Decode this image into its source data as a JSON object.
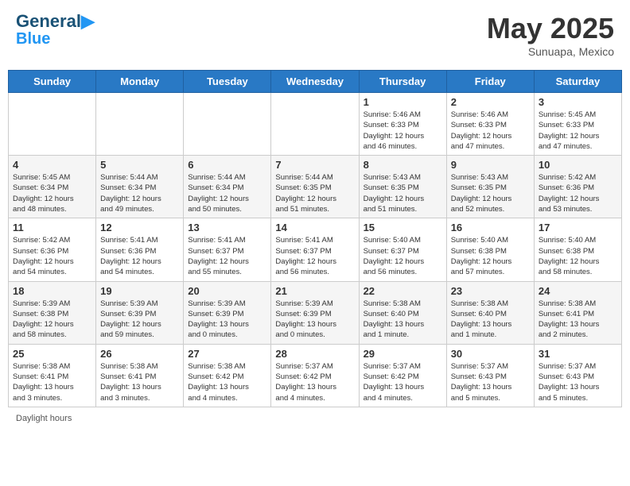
{
  "header": {
    "logo_line1": "General",
    "logo_line2": "Blue",
    "month_title": "May 2025",
    "subtitle": "Sunuapa, Mexico"
  },
  "days_of_week": [
    "Sunday",
    "Monday",
    "Tuesday",
    "Wednesday",
    "Thursday",
    "Friday",
    "Saturday"
  ],
  "weeks": [
    [
      {
        "day": "",
        "info": ""
      },
      {
        "day": "",
        "info": ""
      },
      {
        "day": "",
        "info": ""
      },
      {
        "day": "",
        "info": ""
      },
      {
        "day": "1",
        "info": "Sunrise: 5:46 AM\nSunset: 6:33 PM\nDaylight: 12 hours\nand 46 minutes."
      },
      {
        "day": "2",
        "info": "Sunrise: 5:46 AM\nSunset: 6:33 PM\nDaylight: 12 hours\nand 47 minutes."
      },
      {
        "day": "3",
        "info": "Sunrise: 5:45 AM\nSunset: 6:33 PM\nDaylight: 12 hours\nand 47 minutes."
      }
    ],
    [
      {
        "day": "4",
        "info": "Sunrise: 5:45 AM\nSunset: 6:34 PM\nDaylight: 12 hours\nand 48 minutes."
      },
      {
        "day": "5",
        "info": "Sunrise: 5:44 AM\nSunset: 6:34 PM\nDaylight: 12 hours\nand 49 minutes."
      },
      {
        "day": "6",
        "info": "Sunrise: 5:44 AM\nSunset: 6:34 PM\nDaylight: 12 hours\nand 50 minutes."
      },
      {
        "day": "7",
        "info": "Sunrise: 5:44 AM\nSunset: 6:35 PM\nDaylight: 12 hours\nand 51 minutes."
      },
      {
        "day": "8",
        "info": "Sunrise: 5:43 AM\nSunset: 6:35 PM\nDaylight: 12 hours\nand 51 minutes."
      },
      {
        "day": "9",
        "info": "Sunrise: 5:43 AM\nSunset: 6:35 PM\nDaylight: 12 hours\nand 52 minutes."
      },
      {
        "day": "10",
        "info": "Sunrise: 5:42 AM\nSunset: 6:36 PM\nDaylight: 12 hours\nand 53 minutes."
      }
    ],
    [
      {
        "day": "11",
        "info": "Sunrise: 5:42 AM\nSunset: 6:36 PM\nDaylight: 12 hours\nand 54 minutes."
      },
      {
        "day": "12",
        "info": "Sunrise: 5:41 AM\nSunset: 6:36 PM\nDaylight: 12 hours\nand 54 minutes."
      },
      {
        "day": "13",
        "info": "Sunrise: 5:41 AM\nSunset: 6:37 PM\nDaylight: 12 hours\nand 55 minutes."
      },
      {
        "day": "14",
        "info": "Sunrise: 5:41 AM\nSunset: 6:37 PM\nDaylight: 12 hours\nand 56 minutes."
      },
      {
        "day": "15",
        "info": "Sunrise: 5:40 AM\nSunset: 6:37 PM\nDaylight: 12 hours\nand 56 minutes."
      },
      {
        "day": "16",
        "info": "Sunrise: 5:40 AM\nSunset: 6:38 PM\nDaylight: 12 hours\nand 57 minutes."
      },
      {
        "day": "17",
        "info": "Sunrise: 5:40 AM\nSunset: 6:38 PM\nDaylight: 12 hours\nand 58 minutes."
      }
    ],
    [
      {
        "day": "18",
        "info": "Sunrise: 5:39 AM\nSunset: 6:38 PM\nDaylight: 12 hours\nand 58 minutes."
      },
      {
        "day": "19",
        "info": "Sunrise: 5:39 AM\nSunset: 6:39 PM\nDaylight: 12 hours\nand 59 minutes."
      },
      {
        "day": "20",
        "info": "Sunrise: 5:39 AM\nSunset: 6:39 PM\nDaylight: 13 hours\nand 0 minutes."
      },
      {
        "day": "21",
        "info": "Sunrise: 5:39 AM\nSunset: 6:39 PM\nDaylight: 13 hours\nand 0 minutes."
      },
      {
        "day": "22",
        "info": "Sunrise: 5:38 AM\nSunset: 6:40 PM\nDaylight: 13 hours\nand 1 minute."
      },
      {
        "day": "23",
        "info": "Sunrise: 5:38 AM\nSunset: 6:40 PM\nDaylight: 13 hours\nand 1 minute."
      },
      {
        "day": "24",
        "info": "Sunrise: 5:38 AM\nSunset: 6:41 PM\nDaylight: 13 hours\nand 2 minutes."
      }
    ],
    [
      {
        "day": "25",
        "info": "Sunrise: 5:38 AM\nSunset: 6:41 PM\nDaylight: 13 hours\nand 3 minutes."
      },
      {
        "day": "26",
        "info": "Sunrise: 5:38 AM\nSunset: 6:41 PM\nDaylight: 13 hours\nand 3 minutes."
      },
      {
        "day": "27",
        "info": "Sunrise: 5:38 AM\nSunset: 6:42 PM\nDaylight: 13 hours\nand 4 minutes."
      },
      {
        "day": "28",
        "info": "Sunrise: 5:37 AM\nSunset: 6:42 PM\nDaylight: 13 hours\nand 4 minutes."
      },
      {
        "day": "29",
        "info": "Sunrise: 5:37 AM\nSunset: 6:42 PM\nDaylight: 13 hours\nand 4 minutes."
      },
      {
        "day": "30",
        "info": "Sunrise: 5:37 AM\nSunset: 6:43 PM\nDaylight: 13 hours\nand 5 minutes."
      },
      {
        "day": "31",
        "info": "Sunrise: 5:37 AM\nSunset: 6:43 PM\nDaylight: 13 hours\nand 5 minutes."
      }
    ]
  ],
  "footer": {
    "label": "Daylight hours"
  }
}
